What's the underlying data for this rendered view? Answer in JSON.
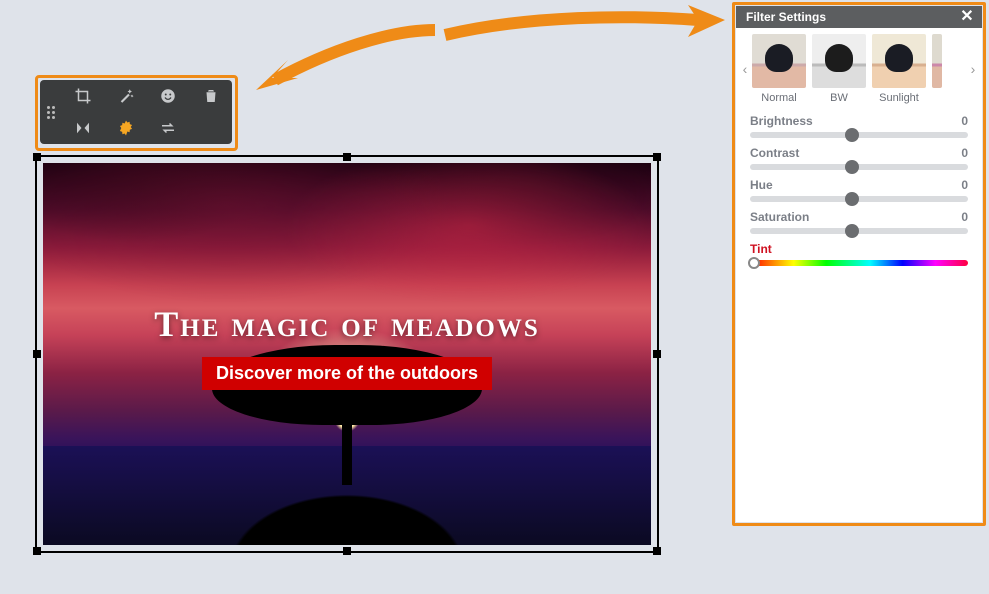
{
  "hero": {
    "title": "The magic of meadows",
    "subtitle": "Discover more of the outdoors"
  },
  "toolbar": {
    "icons": [
      {
        "name": "crop-icon"
      },
      {
        "name": "magic-wand-icon"
      },
      {
        "name": "emoji-icon"
      },
      {
        "name": "trash-icon"
      },
      {
        "name": "flip-icon"
      },
      {
        "name": "filters-gear-icon",
        "active": true
      },
      {
        "name": "swap-icon"
      }
    ]
  },
  "panel": {
    "title": "Filter Settings",
    "presets": [
      {
        "id": "normal",
        "label": "Normal"
      },
      {
        "id": "bw",
        "label": "BW"
      },
      {
        "id": "sunlight",
        "label": "Sunlight"
      }
    ],
    "sliders": [
      {
        "id": "brightness",
        "label": "Brightness",
        "value": 0,
        "thumb_pct": 47
      },
      {
        "id": "contrast",
        "label": "Contrast",
        "value": 0,
        "thumb_pct": 47
      },
      {
        "id": "hue",
        "label": "Hue",
        "value": 0,
        "thumb_pct": 47
      },
      {
        "id": "saturation",
        "label": "Saturation",
        "value": 0,
        "thumb_pct": 47
      }
    ],
    "tint": {
      "label": "Tint",
      "thumb_pct": 2
    }
  },
  "colors": {
    "highlight": "#ef8b17",
    "accent_red": "#d00000",
    "panel_header": "#5c5e60",
    "toolbar_bg": "#3a3c3d"
  }
}
